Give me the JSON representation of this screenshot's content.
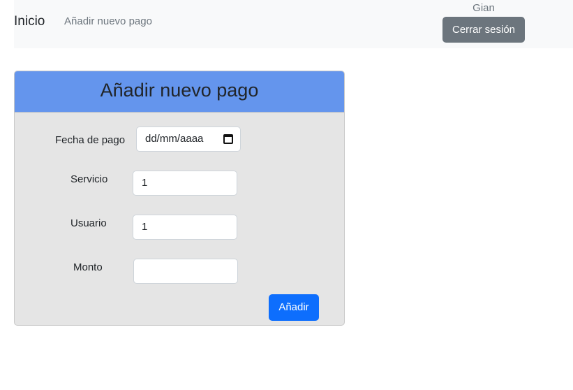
{
  "navbar": {
    "brand": "Inicio",
    "link": "Añadir nuevo pago",
    "user": "Gian",
    "logout_label": "Cerrar sesión"
  },
  "form": {
    "title": "Añadir nuevo pago",
    "fields": {
      "fecha": {
        "label": "Fecha de pago",
        "value": "dd/mm/aaaa"
      },
      "servicio": {
        "label": "Servicio",
        "value": "1"
      },
      "usuario": {
        "label": "Usuario",
        "value": "1"
      },
      "monto": {
        "label": "Monto",
        "value": ""
      }
    },
    "submit_label": "Añadir"
  },
  "colors": {
    "navbar_bg": "#f8f9fa",
    "card_header": "#6495ed",
    "card_body": "#e5e5e5",
    "primary": "#0d6efd",
    "secondary": "#6c757d"
  },
  "icons": {
    "date_picker": "calendar-icon"
  }
}
